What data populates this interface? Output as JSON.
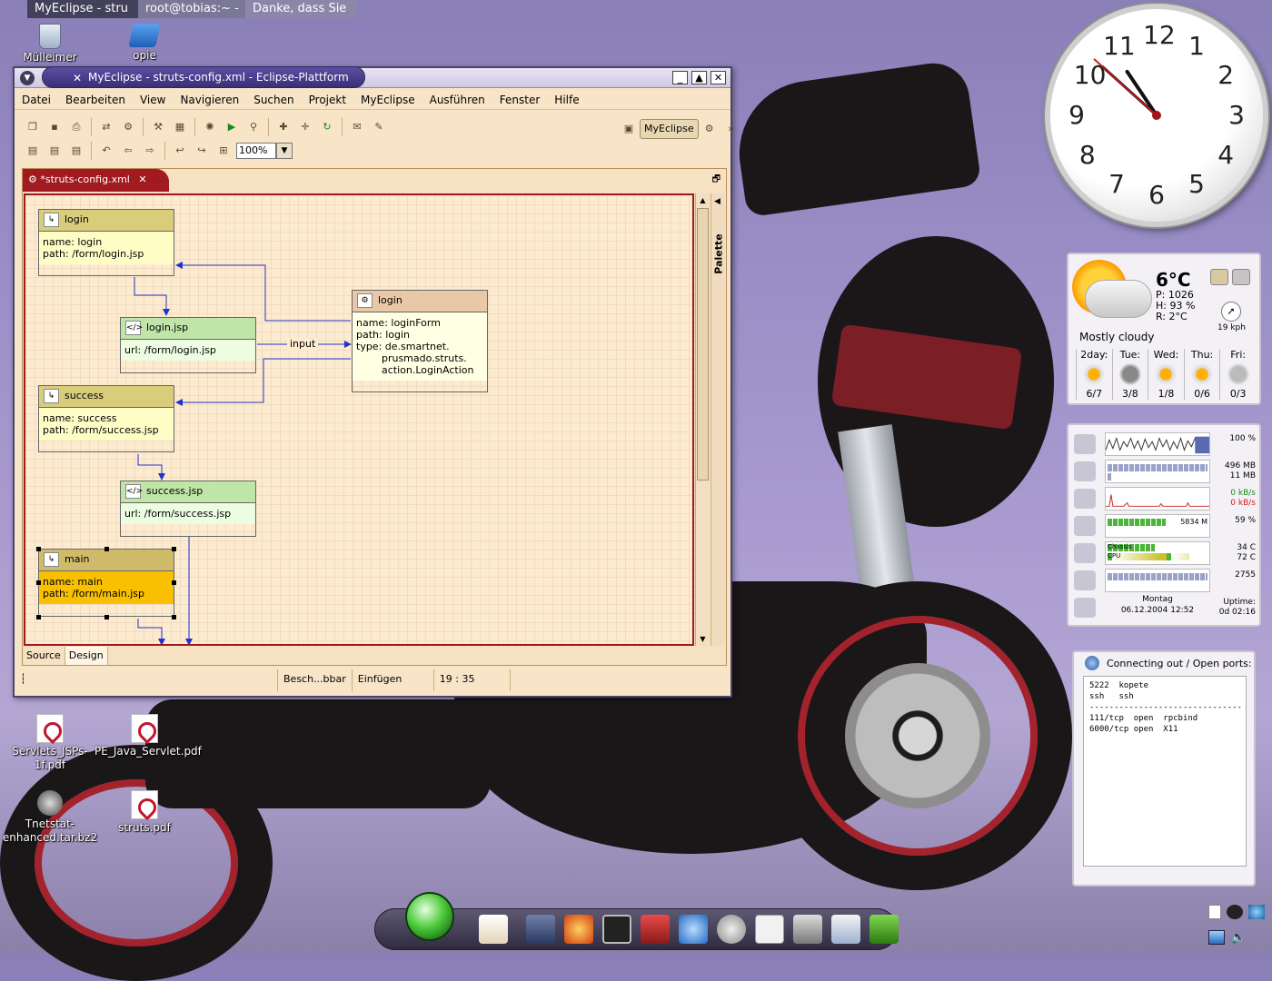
{
  "taskbar": {
    "tasks": [
      "MyEclipse - stru",
      "root@tobias:~ -",
      "Danke, dass Sie"
    ]
  },
  "desktop_icons": [
    {
      "label": "Mülleimer",
      "icon": "trash-icon"
    },
    {
      "label": "opie",
      "icon": "folder-icon"
    },
    {
      "label": "Servlets_JSPs-1f.pdf",
      "icon": "pdf-icon"
    },
    {
      "label": "PE_Java_Servlet.pdf",
      "icon": "pdf-icon"
    },
    {
      "label": "Tnetstat-enhanced.tar.bz2",
      "icon": "archive-icon"
    },
    {
      "label": "struts.pdf",
      "icon": "pdf-icon"
    }
  ],
  "eclipse": {
    "title": "MyEclipse - struts-config.xml - Eclipse-Plattform",
    "menu": [
      "Datei",
      "Bearbeiten",
      "View",
      "Navigieren",
      "Suchen",
      "Projekt",
      "MyEclipse",
      "Ausführen",
      "Fenster",
      "Hilfe"
    ],
    "zoom": "100%",
    "perspective": "MyEclipse",
    "editor_tab": "*struts-config.xml",
    "palette_label": "Palette",
    "bottom_tabs": [
      "Source",
      "Design"
    ],
    "status": {
      "mode": "Besch...bbar",
      "insert": "Einfügen",
      "position": "19 : 35"
    },
    "connection_label": "input",
    "nodes": {
      "login_fwd": {
        "title": "login",
        "body": "name: login\npath: /form/login.jsp"
      },
      "login_jsp": {
        "title": "login.jsp",
        "body": "url: /form/login.jsp"
      },
      "login_action": {
        "title": "login",
        "body": "name: loginForm\npath: login\ntype: de.smartnet.\n        prusmado.struts.\n        action.LoginAction"
      },
      "success_fwd": {
        "title": "success",
        "body": "name: success\npath: /form/success.jsp"
      },
      "success_jsp": {
        "title": "success.jsp",
        "body": "url: /form/success.jsp"
      },
      "main_fwd": {
        "title": "main",
        "body": "name: main\npath: /form/main.jsp"
      }
    }
  },
  "clock": {
    "hour": 10,
    "minute": 52,
    "second": 52
  },
  "weather": {
    "temp": "6°C",
    "pressure": "P: 1026",
    "humidity": "H: 93 %",
    "dew": "R: 2°C",
    "wind": "19 kph",
    "desc": "Mostly cloudy",
    "forecast": [
      {
        "day": "2day:",
        "range": "6/7"
      },
      {
        "day": "Tue:",
        "range": "3/8"
      },
      {
        "day": "Wed:",
        "range": "1/8"
      },
      {
        "day": "Thu:",
        "range": "0/6"
      },
      {
        "day": "Fri:",
        "range": "0/3"
      }
    ]
  },
  "sysmon": {
    "cpu": "100 %",
    "mem1": "496 MB",
    "mem2": "11 MB",
    "net_in": "0 kB/s",
    "net_out": "0 kB/s",
    "disk_label": "5834 M",
    "disk": "59 %",
    "chassis_label": "Chassis",
    "cpu_label": "CPU",
    "temp1": "34 C",
    "temp2": "72 C",
    "fan": "2755",
    "day": "Montag",
    "date": "06.12.2004 12:52",
    "uptime_label": "Uptime:",
    "uptime": "0d 02:16"
  },
  "netstat": {
    "header": "Connecting out / Open ports:",
    "lines": "5222  kopete\nssh   ssh\n-------------------------------\n111/tcp  open  rpcbind\n6000/tcp open  X11"
  },
  "colors": {
    "accent": "#a11a1f",
    "title_pill": "#3a2f7a",
    "window_bg": "#f8e5c8"
  }
}
